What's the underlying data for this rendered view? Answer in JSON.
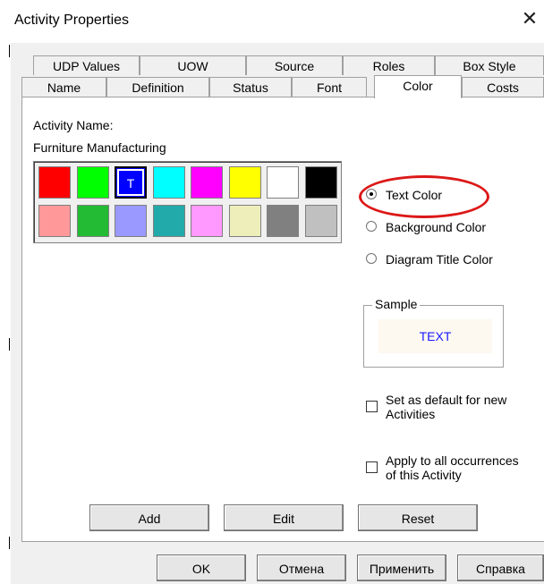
{
  "window": {
    "title": "Activity Properties",
    "close_glyph": "✕"
  },
  "tabs": {
    "row1": [
      "UDP Values",
      "UOW",
      "Source",
      "Roles",
      "Box Style"
    ],
    "row2": [
      "Name",
      "Definition",
      "Status",
      "Font",
      "Color",
      "Costs"
    ],
    "active": "Color"
  },
  "color_tab": {
    "activity_name_label": "Activity Name:",
    "activity_name_value": "Furniture Manufacturing",
    "palette": {
      "row1": [
        "#ff0000",
        "#00ff00",
        "#0000ff",
        "#00ffff",
        "#ff00ff",
        "#ffff00",
        "#ffffff",
        "#000000"
      ],
      "row2": [
        "#ff9999",
        "#22bb33",
        "#9999ff",
        "#22aaaa",
        "#ff99ff",
        "#eeeebb",
        "#808080",
        "#c0c0c0"
      ],
      "selected_marker": "T"
    },
    "radio": {
      "text_color": "Text Color",
      "background_color": "Background Color",
      "diagram_title_color": "Diagram Title Color",
      "selected": "Text Color"
    },
    "sample": {
      "legend": "Sample",
      "text": "TEXT",
      "text_color": "#1a1aff",
      "bg_color": "#fdf8f0"
    },
    "checkboxes": {
      "set_default_line1": "Set as default for new",
      "set_default_line2": "Activities",
      "apply_all_line1": "Apply to all occurrences",
      "apply_all_line2": "of this Activity"
    },
    "buttons": {
      "add": "Add",
      "edit": "Edit",
      "reset": "Reset"
    }
  },
  "footer": {
    "ok": "OK",
    "cancel": "Отмена",
    "apply": "Применить",
    "help": "Справка"
  },
  "highlight_color": "#dc1818"
}
